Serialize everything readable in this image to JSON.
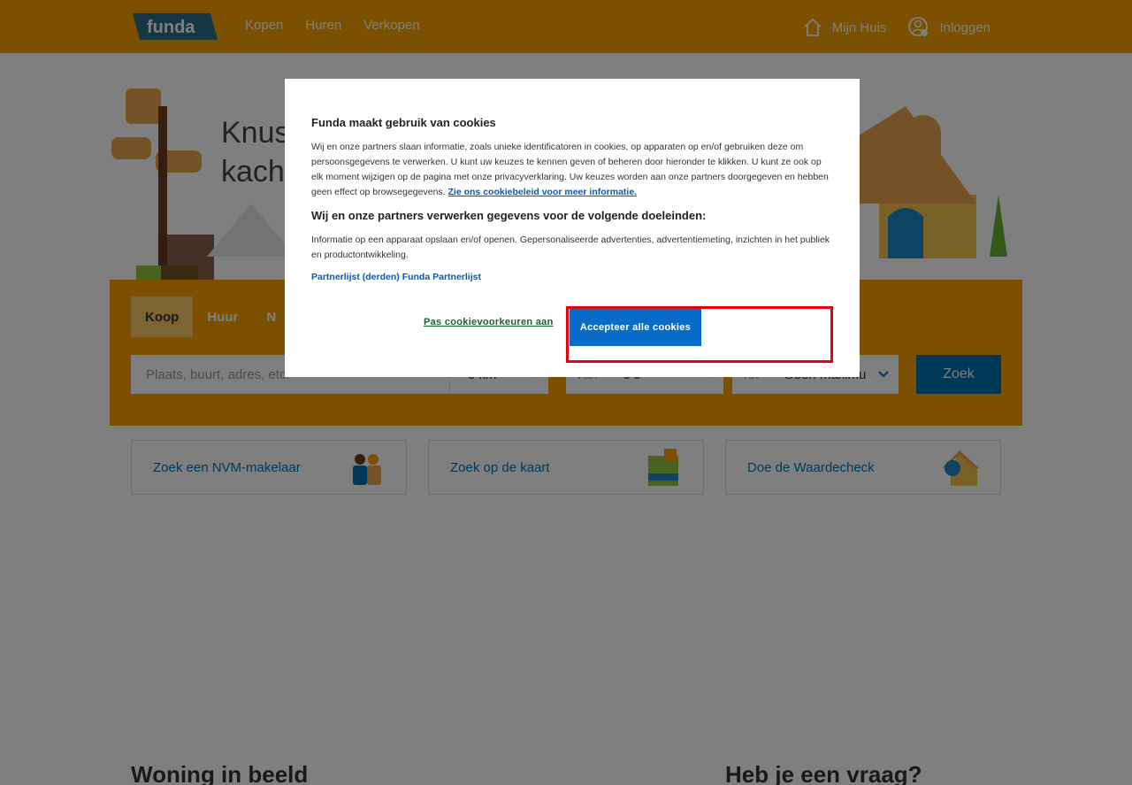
{
  "header": {
    "logo_text": "funda",
    "nav": [
      "Kopen",
      "Huren",
      "Verkopen"
    ],
    "mijn_huis": "Mijn Huis",
    "inloggen": "Inloggen"
  },
  "hero": {
    "title_line1": "Knus",
    "title_line2": "kach"
  },
  "search": {
    "tabs": [
      "Koop",
      "Huur",
      "N"
    ],
    "placeholder": "Plaats, buurt, adres, etc.",
    "radius": "0 km",
    "van_label": "Van",
    "van_value": "€ 0",
    "tot_label": "Tot",
    "tot_value": "Geen maximu",
    "button": "Zoek"
  },
  "cards": [
    {
      "label": "Zoek een NVM-makelaar"
    },
    {
      "label": "Zoek op de kaart"
    },
    {
      "label": "Doe de Waardecheck"
    }
  ],
  "sections": {
    "left": "Woning in beeld",
    "right": "Heb je een vraag?"
  },
  "cookie_dialog": {
    "title": "Funda maakt gebruik van cookies",
    "body": "Wij en onze partners slaan informatie, zoals unieke identificatoren in cookies, op apparaten op en/of gebruiken deze om persoonsgegevens te verwerken. U kunt uw keuzes te kennen geven of beheren door hieronder te klikken. U kunt ze ook op elk moment wijzigen op de pagina met onze privacyverklaring. Uw keuzes worden aan onze partners doorgegeven en hebben geen effect op browsegegevens.",
    "policy_link": "Zie ons cookiebeleid voor meer informatie.",
    "purposes_title": "Wij en onze partners verwerken gegevens voor de volgende doeleinden:",
    "purposes_text": "Informatie op een apparaat opslaan en/of openen. Gepersonaliseerde advertenties, advertentiemeting, inzichten in het publiek en productontwikkeling.",
    "partner_link": "Partnerlijst (derden) Funda Partnerlijst",
    "customize_button": "Pas cookievoorkeuren aan",
    "accept_button": "Accepteer alle cookies"
  },
  "colors": {
    "brand_orange": "#f7a100",
    "brand_blue": "#0071b3",
    "accept_blue": "#0a6cc9",
    "highlight_red": "#e8000d"
  }
}
